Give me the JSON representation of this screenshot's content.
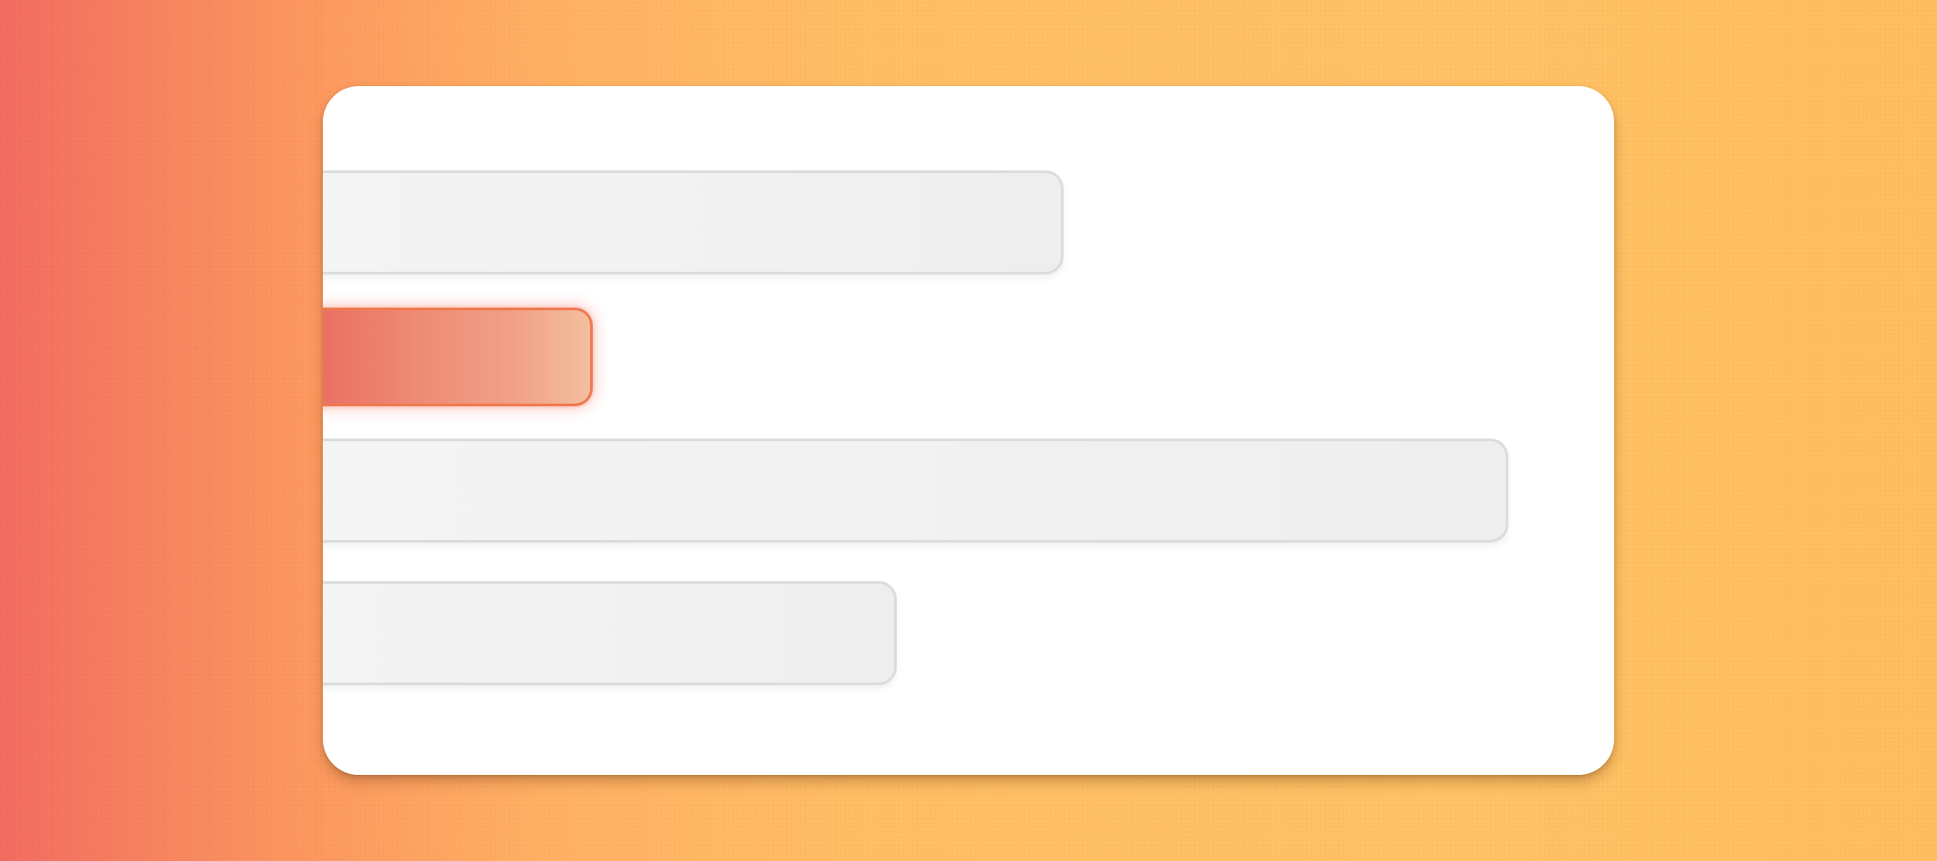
{
  "background": {
    "gradient_colors": [
      "#f26b61",
      "#fc985f",
      "#ffbe64"
    ]
  },
  "card": {
    "color": "#ffffff"
  },
  "bars": [
    {
      "state": "placeholder",
      "color": "#f1f1f1",
      "relative_length": 0.63
    },
    {
      "state": "highlighted",
      "color": "#ee8a75",
      "relative_length": 0.24
    },
    {
      "state": "placeholder",
      "color": "#f1f1f1",
      "relative_length": 1.0
    },
    {
      "state": "placeholder",
      "color": "#f1f1f1",
      "relative_length": 0.5
    }
  ]
}
